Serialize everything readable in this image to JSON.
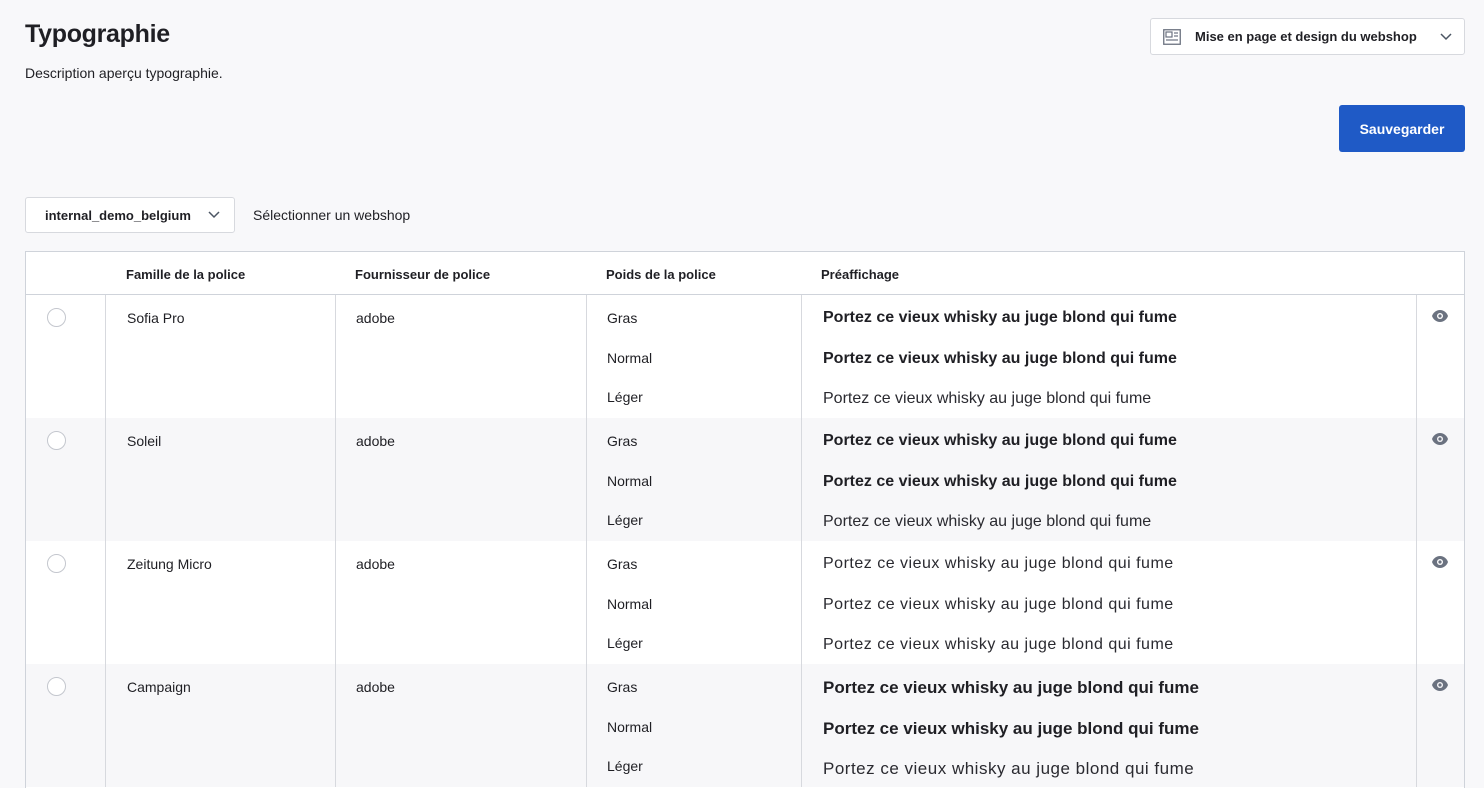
{
  "header": {
    "title": "Typographie",
    "description": "Description aperçu typographie.",
    "section_selector": "Mise en page et design du webshop",
    "save_label": "Sauvegarder"
  },
  "webshop": {
    "selected": "internal_demo_belgium",
    "hint": "Sélectionner un webshop"
  },
  "table": {
    "columns": [
      "Famille de la police",
      "Fournisseur de police",
      "Poids de la police",
      "Préaffichage"
    ],
    "weights": [
      "Gras",
      "Normal",
      "Léger"
    ],
    "preview_text": "Portez ce vieux whisky au juge blond qui fume",
    "rows": [
      {
        "family": "Sofia Pro",
        "provider": "adobe"
      },
      {
        "family": "Soleil",
        "provider": "adobe"
      },
      {
        "family": "Zeitung Micro",
        "provider": "adobe"
      },
      {
        "family": "Campaign",
        "provider": "adobe"
      }
    ]
  },
  "colors": {
    "primary": "#1f5ac6",
    "background": "#f8f8fa",
    "border": "#cfd3da"
  },
  "icons": [
    "layout-icon",
    "chevron-down-icon",
    "eye-icon"
  ]
}
